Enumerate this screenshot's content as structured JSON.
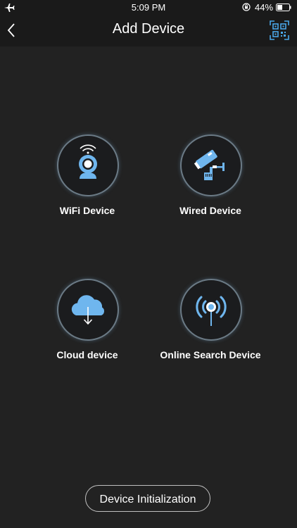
{
  "status_bar": {
    "time": "5:09 PM",
    "battery_percent": "44%",
    "battery_level": 0.44,
    "icons": [
      "airplane-icon",
      "rotation-lock-icon",
      "battery-icon"
    ]
  },
  "nav": {
    "title": "Add Device",
    "back_icon": "chevron-left-icon",
    "scan_icon": "qr-scan-icon"
  },
  "options": [
    {
      "label": "WiFi Device",
      "icon": "wifi-camera-icon"
    },
    {
      "label": "Wired Device",
      "icon": "wired-camera-icon"
    },
    {
      "label": "Cloud device",
      "icon": "cloud-download-icon"
    },
    {
      "label": "Online Search Device",
      "icon": "signal-broadcast-icon"
    }
  ],
  "footer": {
    "init_label": "Device Initialization"
  },
  "colors": {
    "background": "#222222",
    "bar": "#1a1a1a",
    "accent": "#5aa9e6",
    "circle_border": "#6b7a85"
  }
}
